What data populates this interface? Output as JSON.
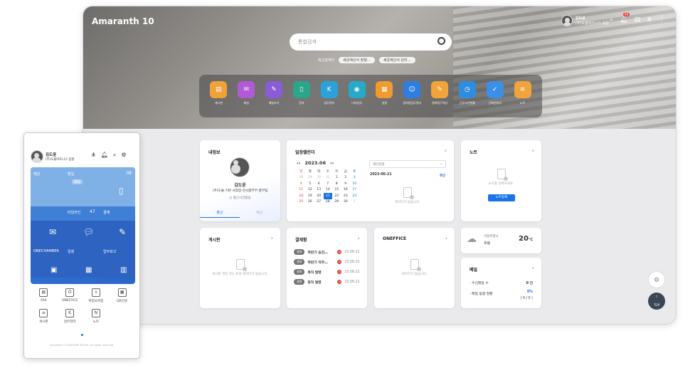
{
  "desktop": {
    "logo": "Amaranth 10",
    "user": {
      "name": "김도윤",
      "dept": "(주)도율비즈니스 팀원"
    },
    "notif_count": "99",
    "search": {
      "placeholder": "통합검색"
    },
    "recent": {
      "label": "최근검색어",
      "items": [
        "세금계산서 발행…",
        "세금계산서 관리…"
      ]
    },
    "apps": [
      {
        "label": "게시판",
        "color": "#f0a23a",
        "icon": "board-icon"
      },
      {
        "label": "메일",
        "color": "#b05bd3",
        "icon": "mail-icon"
      },
      {
        "label": "메일쓰기",
        "color": "#8b5cd6",
        "icon": "compose-icon"
      },
      {
        "label": "문자",
        "color": "#2ca58d",
        "icon": "phone-icon"
      },
      {
        "label": "업무관리",
        "color": "#2aa2d8",
        "icon": "kiss-icon"
      },
      {
        "label": "나의업무",
        "color": "#27a9c9",
        "icon": "task-icon"
      },
      {
        "label": "일정",
        "color": "#f29a2e",
        "icon": "calendar-icon"
      },
      {
        "label": "임직원업무관리",
        "color": "#2f7de1",
        "icon": "employee-icon"
      },
      {
        "label": "경비청구작성",
        "color": "#f2a33a",
        "icon": "expense-icon"
      },
      {
        "label": "근무시간현황",
        "color": "#2d8de0",
        "icon": "worktime-icon"
      },
      {
        "label": "근태신청서",
        "color": "#3a8fe6",
        "icon": "attendance-icon"
      },
      {
        "label": "노트",
        "color": "#f0a43b",
        "icon": "note-icon"
      }
    ],
    "cards": {
      "profile": {
        "title": "내정보",
        "name": "김도윤",
        "dept": "(주)도율-기본 사업장-전사총무부-총무팀",
        "checkin_status": "출근시간없음",
        "btn_in": "출근",
        "btn_out": "퇴근"
      },
      "calendar": {
        "title": "일정캘린더",
        "month": "2023.06",
        "weekdays": [
          "일",
          "월",
          "화",
          "수",
          "목",
          "금",
          "토"
        ],
        "weeks": [
          [
            "28",
            "29",
            "30",
            "31",
            "1",
            "2",
            "3"
          ],
          [
            "4",
            "5",
            "6",
            "7",
            "8",
            "9",
            "10"
          ],
          [
            "11",
            "12",
            "13",
            "14",
            "15",
            "16",
            "17"
          ],
          [
            "18",
            "19",
            "20",
            "21",
            "22",
            "23",
            "24"
          ],
          [
            "25",
            "26",
            "27",
            "28",
            "29",
            "30",
            "1"
          ]
        ],
        "selected_day": "21",
        "filter": "개인일정",
        "date": "2023-06-21",
        "count": "0건",
        "empty": "데이터가 없습니다."
      },
      "note": {
        "title": "노트",
        "empty": "노트를 등록하세요.",
        "button": "노트등록"
      },
      "board": {
        "title": "게시판",
        "empty": "게시판 관련 하는 표의 데이터가 없습니다."
      },
      "approval": {
        "title": "결재함",
        "items": [
          {
            "tag": "결재",
            "title": "하반기 승진…",
            "date": "23.06.21"
          },
          {
            "tag": "결재",
            "title": "하반기 직무…",
            "date": "23.06.21"
          },
          {
            "tag": "결재",
            "title": "복직 발령",
            "date": "23.06.21"
          },
          {
            "tag": "결재",
            "title": "휴직 발령",
            "date": "23.06.21"
          }
        ]
      },
      "oneffice": {
        "title": "ONEFFICE",
        "empty": "데이터가 없습니다."
      },
      "weather": {
        "location": "서울특별시",
        "status": "흐림",
        "temp": "20",
        "unit": "℃"
      },
      "mail": {
        "title": "메일",
        "rows": [
          {
            "label": "· 수신메일 수",
            "value": "0 건"
          },
          {
            "label": "· 메일 용량 현황",
            "value": "0%",
            "sub": "( 0 / 0 )"
          }
        ]
      }
    },
    "top_label": "TOP"
  },
  "mobile": {
    "user": {
      "name": "김도윤",
      "dept": "(주)도율비즈니스 팀원"
    },
    "tiles": {
      "mail": "메일",
      "todo": "할일",
      "todo_count": "08",
      "memo": "메모",
      "timeline": "타임라인",
      "timeline_count": "47",
      "approval": "결재",
      "onechamber": "ONECHAMBER",
      "schedule": "일정",
      "report": "업무보고"
    },
    "grid": [
      {
        "label": "FAX",
        "icon": "fax-icon"
      },
      {
        "label": "ONEFFICE",
        "icon": "oneffice-icon"
      },
      {
        "label": "파일보관함",
        "icon": "download-icon"
      },
      {
        "label": "QR인증",
        "icon": "qr-icon"
      },
      {
        "label": "게시판",
        "icon": "board-icon"
      },
      {
        "label": "업무관리",
        "icon": "kiss-icon"
      },
      {
        "label": "노트",
        "icon": "note-icon"
      }
    ],
    "copyright": "Copyright © DOUZONE BIZON. All rights reserved."
  }
}
